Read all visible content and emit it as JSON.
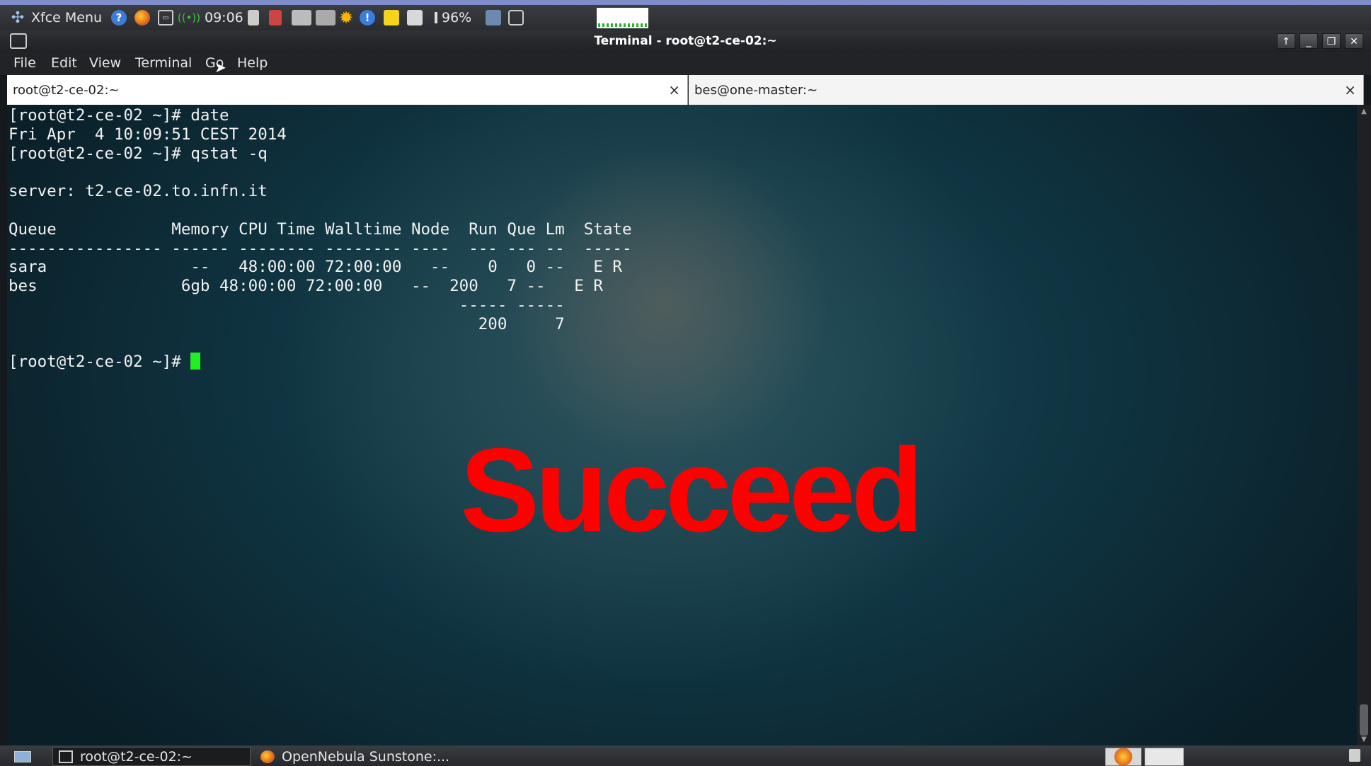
{
  "top_panel": {
    "menu_label": "Xfce Menu",
    "clock": "09:06",
    "battery": "96%",
    "icons": [
      "xfce-logo-icon",
      "help-icon",
      "firefox-icon",
      "terminal-launcher-icon",
      "network-signal-icon",
      "calculator-icon",
      "app-icon",
      "network-manager-icon",
      "display-icon",
      "brightness-icon",
      "notification-icon",
      "notes-icon",
      "file-manager-icon",
      "battery-icon",
      "mail-icon",
      "screenshot-icon",
      "cpu-graph-icon"
    ]
  },
  "window": {
    "title": "Terminal - root@t2-ce-02:~",
    "controls": [
      "↑",
      "_",
      "❐",
      "✕"
    ]
  },
  "menu": [
    "File",
    "Edit",
    "View",
    "Terminal",
    "Go",
    "Help"
  ],
  "tabs": [
    {
      "label": "root@t2-ce-02:~",
      "close": "×"
    },
    {
      "label": "bes@one-master:~",
      "close": "×"
    }
  ],
  "terminal": {
    "lines": [
      "[root@t2-ce-02 ~]# date",
      "Fri Apr  4 10:09:51 CEST 2014",
      "[root@t2-ce-02 ~]# qstat -q",
      "",
      "server: t2-ce-02.to.infn.it",
      "",
      "Queue            Memory CPU Time Walltime Node  Run Que Lm  State",
      "---------------- ------ -------- -------- ----  --- --- --  -----",
      "sara               --   48:00:00 72:00:00   --    0   0 --   E R",
      "bes               6gb 48:00:00 72:00:00   --  200   7 --   E R",
      "                                               ----- -----",
      "                                                 200     7",
      ""
    ],
    "prompt": "[root@t2-ce-02 ~]# ",
    "overlay_text": "Succeed"
  },
  "taskbar": {
    "tasks": [
      {
        "label": "root@t2-ce-02:~",
        "icon": "terminal-icon",
        "active": true
      },
      {
        "label": "OpenNebula Sunstone:...",
        "icon": "firefox-icon",
        "active": false
      }
    ],
    "tray_icons": [
      "firefox-tray-icon",
      "terminal-tray-icon",
      "trash-icon"
    ]
  },
  "colors": {
    "overlay": "#ff0000",
    "cursor": "#22ee22",
    "terminal_text": "#f2f2f2"
  }
}
